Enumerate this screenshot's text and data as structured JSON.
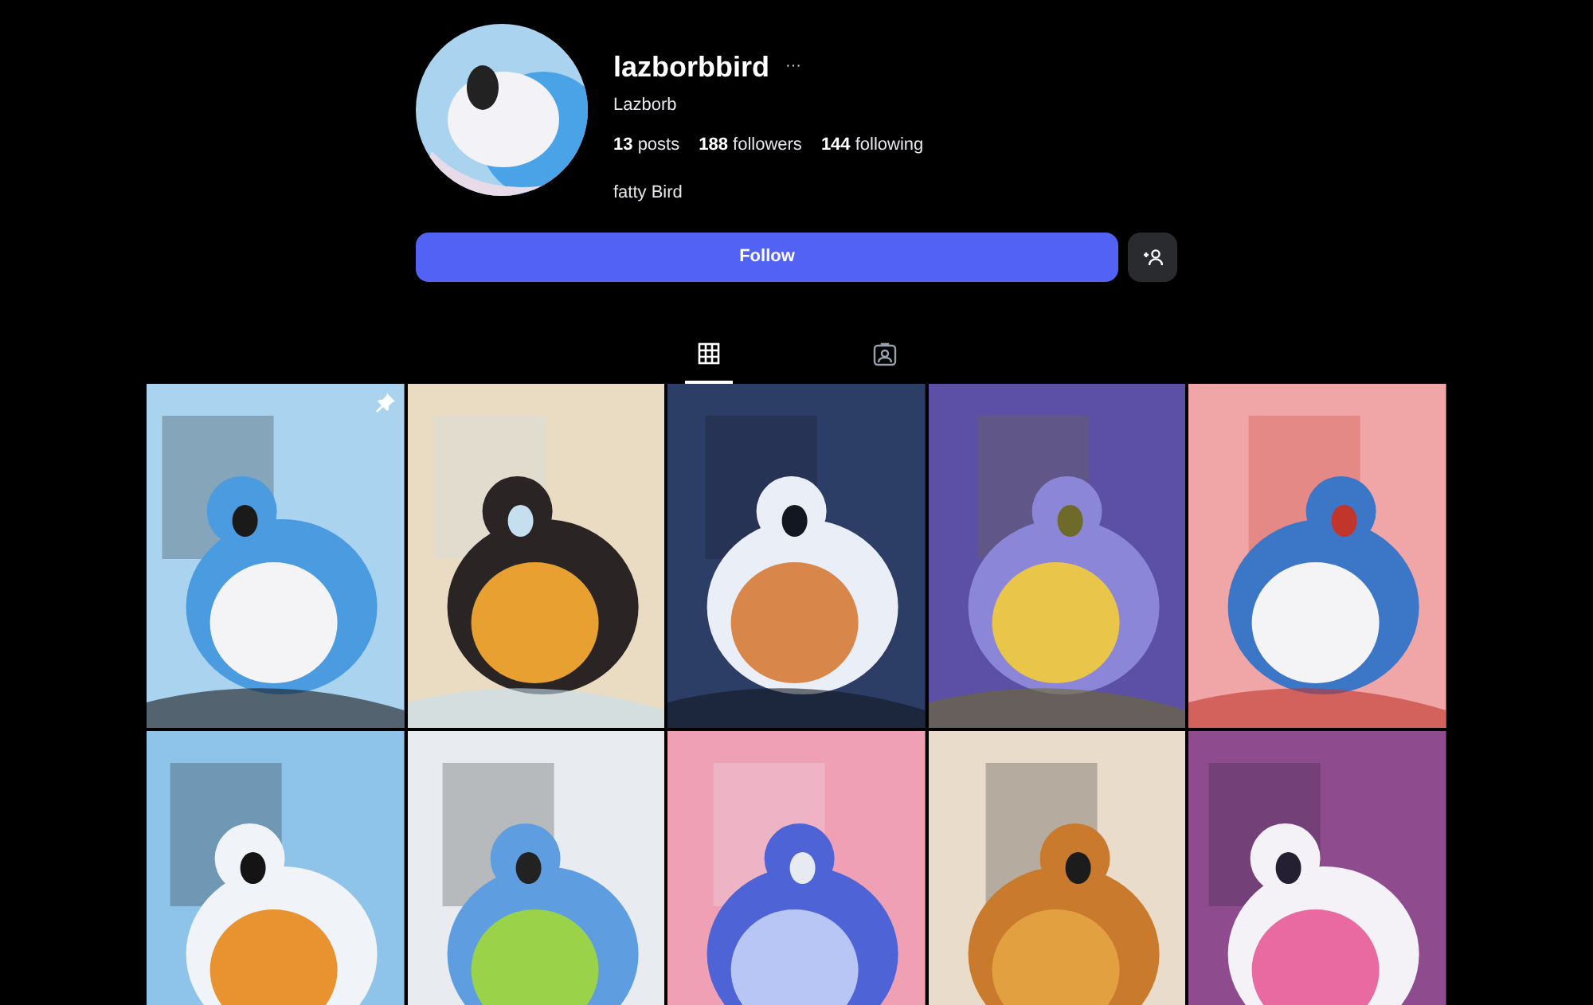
{
  "profile": {
    "username": "lazborbbird",
    "more": "···",
    "display_name": "Lazborb",
    "stats": [
      {
        "count": "13",
        "label": "posts"
      },
      {
        "count": "188",
        "label": "followers"
      },
      {
        "count": "144",
        "label": "following"
      }
    ],
    "bio": "fatty Bird"
  },
  "follow_button": {
    "label": "Follow"
  },
  "tabs": [
    {
      "kind": "grid",
      "selected": true
    },
    {
      "kind": "tagged",
      "selected": false
    }
  ],
  "posts": [
    {
      "kind": "picture",
      "pinned": true
    },
    {
      "kind": "picture",
      "pinned": false
    },
    {
      "kind": "picture",
      "pinned": false
    },
    {
      "kind": "picture",
      "pinned": false
    },
    {
      "kind": "picture",
      "pinned": false
    },
    {
      "kind": "picture",
      "pinned": false
    },
    {
      "kind": "picture",
      "pinned": false
    },
    {
      "kind": "picture",
      "pinned": false
    },
    {
      "kind": "picture",
      "pinned": false
    },
    {
      "kind": "picture",
      "pinned": false
    }
  ]
}
